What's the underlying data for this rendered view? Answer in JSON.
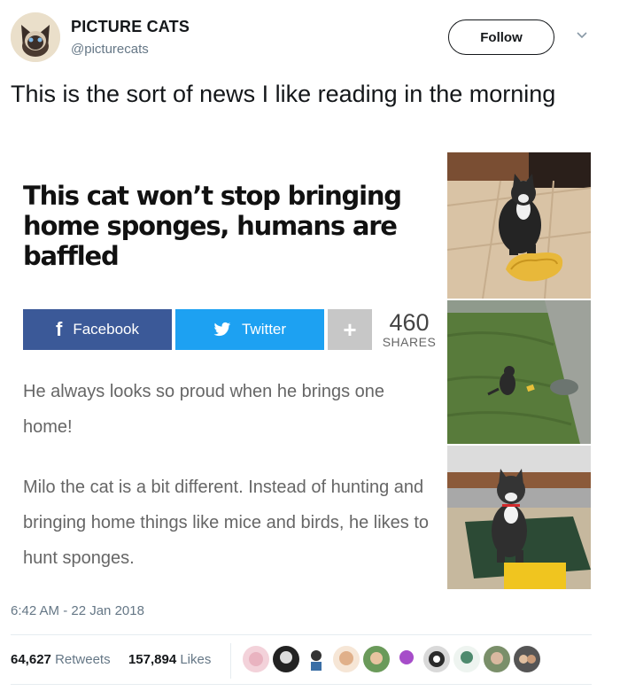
{
  "tweet": {
    "display_name": "PICTURE CATS",
    "handle": "@picturecats",
    "follow_label": "Follow",
    "text": "This is the sort of news I like reading in the morning",
    "timestamp": "6:42 AM - 22 Jan 2018",
    "retweets_count": "64,627",
    "retweets_label": "Retweets",
    "likes_count": "157,894",
    "likes_label": "Likes"
  },
  "article": {
    "headline": "This cat won’t stop bringing home sponges, humans are baffled",
    "facebook_label": "Facebook",
    "twitter_label": "Twitter",
    "plus_label": "+",
    "shares_count": "460",
    "shares_label": "SHARES",
    "paragraph1": "He always looks so proud when he brings one home!",
    "paragraph2": "Milo the cat is a bit different. Instead of hunting and bringing home things like mice and birds, he likes to hunt sponges."
  },
  "colors": {
    "facebook": "#3b5998",
    "twitter": "#1da1f2",
    "link": "#657786"
  },
  "icons": {
    "caret": "chevron-down-icon",
    "facebook": "facebook-icon",
    "twitter": "twitter-bird-icon"
  }
}
